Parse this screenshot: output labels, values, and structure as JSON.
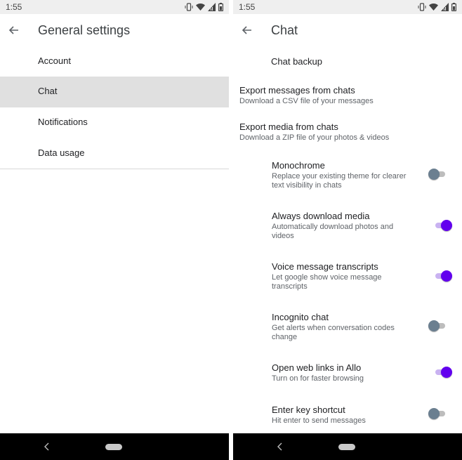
{
  "left": {
    "status_time": "1:55",
    "title": "General settings",
    "menu": [
      {
        "label": "Account"
      },
      {
        "label": "Chat"
      },
      {
        "label": "Notifications"
      },
      {
        "label": "Data usage"
      }
    ]
  },
  "right": {
    "status_time": "1:55",
    "title": "Chat",
    "chat_backup": "Chat backup",
    "export_messages": {
      "title": "Export messages from chats",
      "subtitle": "Download a CSV file of your messages"
    },
    "export_media": {
      "title": "Export media from chats",
      "subtitle": "Download a ZIP file of your photos & videos"
    },
    "settings": [
      {
        "title": "Monochrome",
        "subtitle": "Replace your existing theme for clearer text visibility in chats",
        "enabled": false
      },
      {
        "title": "Always download media",
        "subtitle": "Automatically download photos and videos",
        "enabled": true
      },
      {
        "title": "Voice message transcripts",
        "subtitle": "Let google show voice message transcripts",
        "enabled": true
      },
      {
        "title": "Incognito chat",
        "subtitle": "Get alerts when conversation codes change",
        "enabled": false
      },
      {
        "title": "Open web links in Allo",
        "subtitle": "Turn on for faster browsing",
        "enabled": true
      },
      {
        "title": "Enter key shortcut",
        "subtitle": "Hit enter to send messages",
        "enabled": false
      }
    ]
  },
  "icons": {
    "status": [
      "vibrate-icon",
      "wifi-icon",
      "signal-icon",
      "battery-icon"
    ],
    "back": "back-arrow-icon"
  },
  "colors": {
    "accent": "#6200ee",
    "toggle_on_track": "#c9b2f1",
    "toggle_off_thumb": "#6b7f90",
    "selected_bg": "#e0e0e0"
  }
}
